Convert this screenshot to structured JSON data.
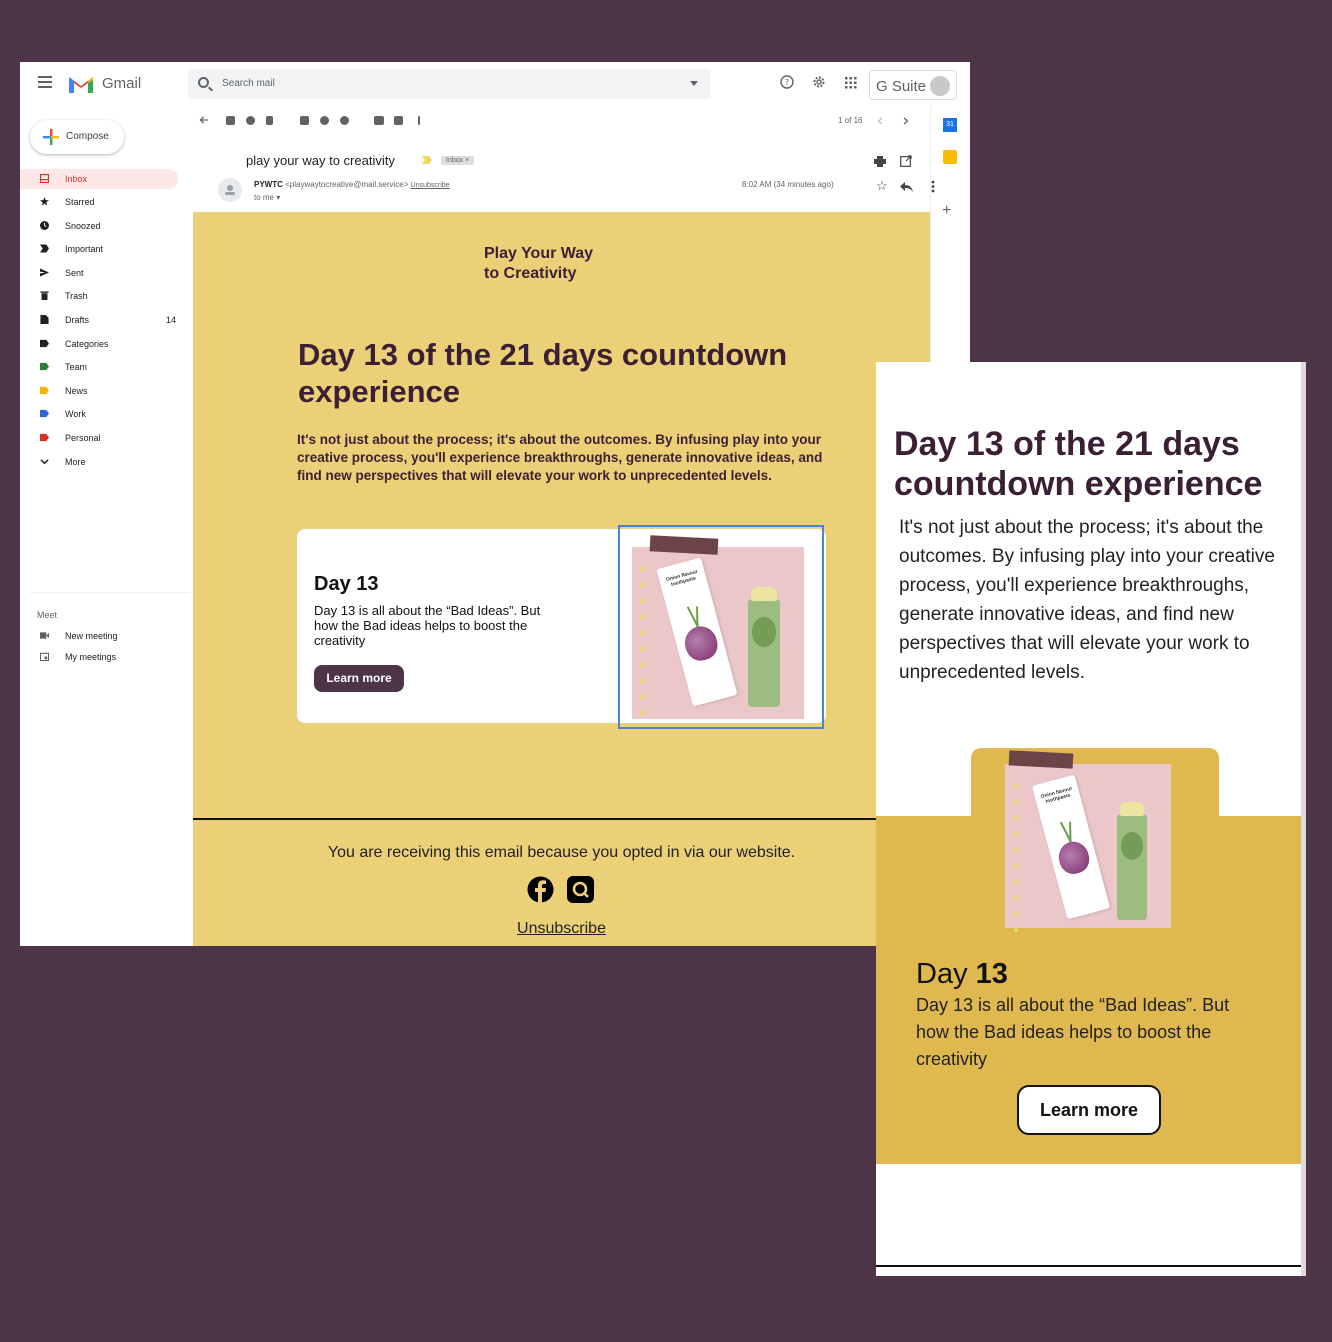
{
  "gmail": {
    "app_name": "Gmail",
    "search_placeholder": "Search mail",
    "gsuite_label": "G Suite",
    "compose_label": "Compose",
    "nav": [
      {
        "label": "Inbox",
        "count": ""
      },
      {
        "label": "Starred",
        "count": ""
      },
      {
        "label": "Snoozed",
        "count": ""
      },
      {
        "label": "Important",
        "count": ""
      },
      {
        "label": "Sent",
        "count": ""
      },
      {
        "label": "Trash",
        "count": ""
      },
      {
        "label": "Drafts",
        "count": "14"
      },
      {
        "label": "Categories",
        "count": ""
      },
      {
        "label": "Team",
        "count": ""
      },
      {
        "label": "News",
        "count": ""
      },
      {
        "label": "Work",
        "count": ""
      },
      {
        "label": "Personal",
        "count": ""
      },
      {
        "label": "More",
        "count": ""
      }
    ],
    "nav_colors": {
      "Team": "#2e7d32",
      "News": "#f4b400",
      "Work": "#3367d6",
      "Personal": "#d93025"
    },
    "meet": {
      "heading": "Meet",
      "items": [
        "New meeting",
        "My meetings"
      ]
    },
    "pager": "1 of 16",
    "calendar_label": "31",
    "message": {
      "subject": "play your way to creativity",
      "label_chip": "Inbox ×",
      "sender_name": "PYWTC",
      "sender_email": "<playwaytocreative@mail.service>",
      "unsubscribe_link": "Unsubscribe",
      "to": "to me",
      "time": "8:02 AM (34 minutes ago)"
    }
  },
  "email": {
    "brand_line1": "Play Your Way",
    "brand_line2": "to Creativity",
    "headline": "Day 13 of the 21 days countdown experience",
    "intro": "It's not just about the process; it's about the outcomes. By infusing play into your creative process, you'll experience breakthroughs, generate innovative ideas, and find new perspectives that will elevate your work to unprecedented levels.",
    "card_title": "Day 13",
    "card_text": "Day 13 is all about the “Bad Ideas”. But how the Bad ideas helps to boost the creativity",
    "button": "Learn more",
    "product_label": "Onion flavour toothpaste",
    "footer_note": "You are receiving this email because you opted in via our website.",
    "social_icons": [
      "facebook-icon",
      "search-icon"
    ],
    "unsubscribe": "Unsubscribe",
    "colors": {
      "background": "#ebd077",
      "accent": "#4d3449",
      "text": "#3b1f34"
    }
  },
  "mobile": {
    "headline": "Day 13 of the 21 days countdown experience",
    "intro": "It's not just about the process; it's about the outcomes. By infusing play into your creative process, you'll experience breakthroughs, generate innovative ideas, and find new perspectives that will elevate your work to unprecedented levels.",
    "day_word": "Day",
    "day_number": "13",
    "day_text": "Day 13 is all about the “Bad Ideas”. But how the Bad ideas helps to boost the creativity",
    "button": "Learn more",
    "band_color": "#e0b850"
  }
}
